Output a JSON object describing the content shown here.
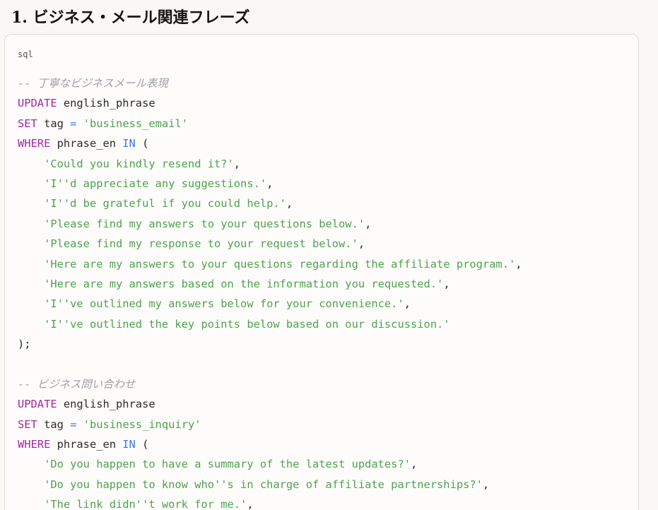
{
  "section": {
    "heading": "1. ビジネス・メール関連フレーズ"
  },
  "code_block": {
    "language": "sql",
    "lines": [
      [
        {
          "t": "comment",
          "v": "-- 丁寧なビジネスメール表現"
        }
      ],
      [
        {
          "t": "keyword",
          "v": "UPDATE"
        },
        {
          "t": "plain",
          "v": " english_phrase"
        }
      ],
      [
        {
          "t": "keyword",
          "v": "SET"
        },
        {
          "t": "plain",
          "v": " tag "
        },
        {
          "t": "operator",
          "v": "="
        },
        {
          "t": "plain",
          "v": " "
        },
        {
          "t": "string",
          "v": "'business_email'"
        }
      ],
      [
        {
          "t": "keyword",
          "v": "WHERE"
        },
        {
          "t": "plain",
          "v": " phrase_en "
        },
        {
          "t": "operator",
          "v": "IN"
        },
        {
          "t": "plain",
          "v": " ("
        }
      ],
      [
        {
          "t": "plain",
          "v": "    "
        },
        {
          "t": "string",
          "v": "'Could you kindly resend it?'"
        },
        {
          "t": "plain",
          "v": ","
        }
      ],
      [
        {
          "t": "plain",
          "v": "    "
        },
        {
          "t": "string",
          "v": "'I''d appreciate any suggestions.'"
        },
        {
          "t": "plain",
          "v": ","
        }
      ],
      [
        {
          "t": "plain",
          "v": "    "
        },
        {
          "t": "string",
          "v": "'I''d be grateful if you could help.'"
        },
        {
          "t": "plain",
          "v": ","
        }
      ],
      [
        {
          "t": "plain",
          "v": "    "
        },
        {
          "t": "string",
          "v": "'Please find my answers to your questions below.'"
        },
        {
          "t": "plain",
          "v": ","
        }
      ],
      [
        {
          "t": "plain",
          "v": "    "
        },
        {
          "t": "string",
          "v": "'Please find my response to your request below.'"
        },
        {
          "t": "plain",
          "v": ","
        }
      ],
      [
        {
          "t": "plain",
          "v": "    "
        },
        {
          "t": "string",
          "v": "'Here are my answers to your questions regarding the affiliate program.'"
        },
        {
          "t": "plain",
          "v": ","
        }
      ],
      [
        {
          "t": "plain",
          "v": "    "
        },
        {
          "t": "string",
          "v": "'Here are my answers based on the information you requested.'"
        },
        {
          "t": "plain",
          "v": ","
        }
      ],
      [
        {
          "t": "plain",
          "v": "    "
        },
        {
          "t": "string",
          "v": "'I''ve outlined my answers below for your convenience.'"
        },
        {
          "t": "plain",
          "v": ","
        }
      ],
      [
        {
          "t": "plain",
          "v": "    "
        },
        {
          "t": "string",
          "v": "'I''ve outlined the key points below based on our discussion.'"
        }
      ],
      [
        {
          "t": "plain",
          "v": ");"
        }
      ],
      [],
      [
        {
          "t": "comment",
          "v": "-- ビジネス問い合わせ"
        }
      ],
      [
        {
          "t": "keyword",
          "v": "UPDATE"
        },
        {
          "t": "plain",
          "v": " english_phrase"
        }
      ],
      [
        {
          "t": "keyword",
          "v": "SET"
        },
        {
          "t": "plain",
          "v": " tag "
        },
        {
          "t": "operator",
          "v": "="
        },
        {
          "t": "plain",
          "v": " "
        },
        {
          "t": "string",
          "v": "'business_inquiry'"
        }
      ],
      [
        {
          "t": "keyword",
          "v": "WHERE"
        },
        {
          "t": "plain",
          "v": " phrase_en "
        },
        {
          "t": "operator",
          "v": "IN"
        },
        {
          "t": "plain",
          "v": " ("
        }
      ],
      [
        {
          "t": "plain",
          "v": "    "
        },
        {
          "t": "string",
          "v": "'Do you happen to have a summary of the latest updates?'"
        },
        {
          "t": "plain",
          "v": ","
        }
      ],
      [
        {
          "t": "plain",
          "v": "    "
        },
        {
          "t": "string",
          "v": "'Do you happen to know who''s in charge of affiliate partnerships?'"
        },
        {
          "t": "plain",
          "v": ","
        }
      ],
      [
        {
          "t": "plain",
          "v": "    "
        },
        {
          "t": "string",
          "v": "'The link didn''t work for me.'"
        },
        {
          "t": "plain",
          "v": ","
        }
      ]
    ]
  },
  "colors": {
    "background": "#f9f8f5",
    "code_background": "#fdfcfb",
    "keyword": "#a626a4",
    "operator": "#4078f2",
    "string": "#50a14f",
    "comment": "#a0a1a7"
  }
}
